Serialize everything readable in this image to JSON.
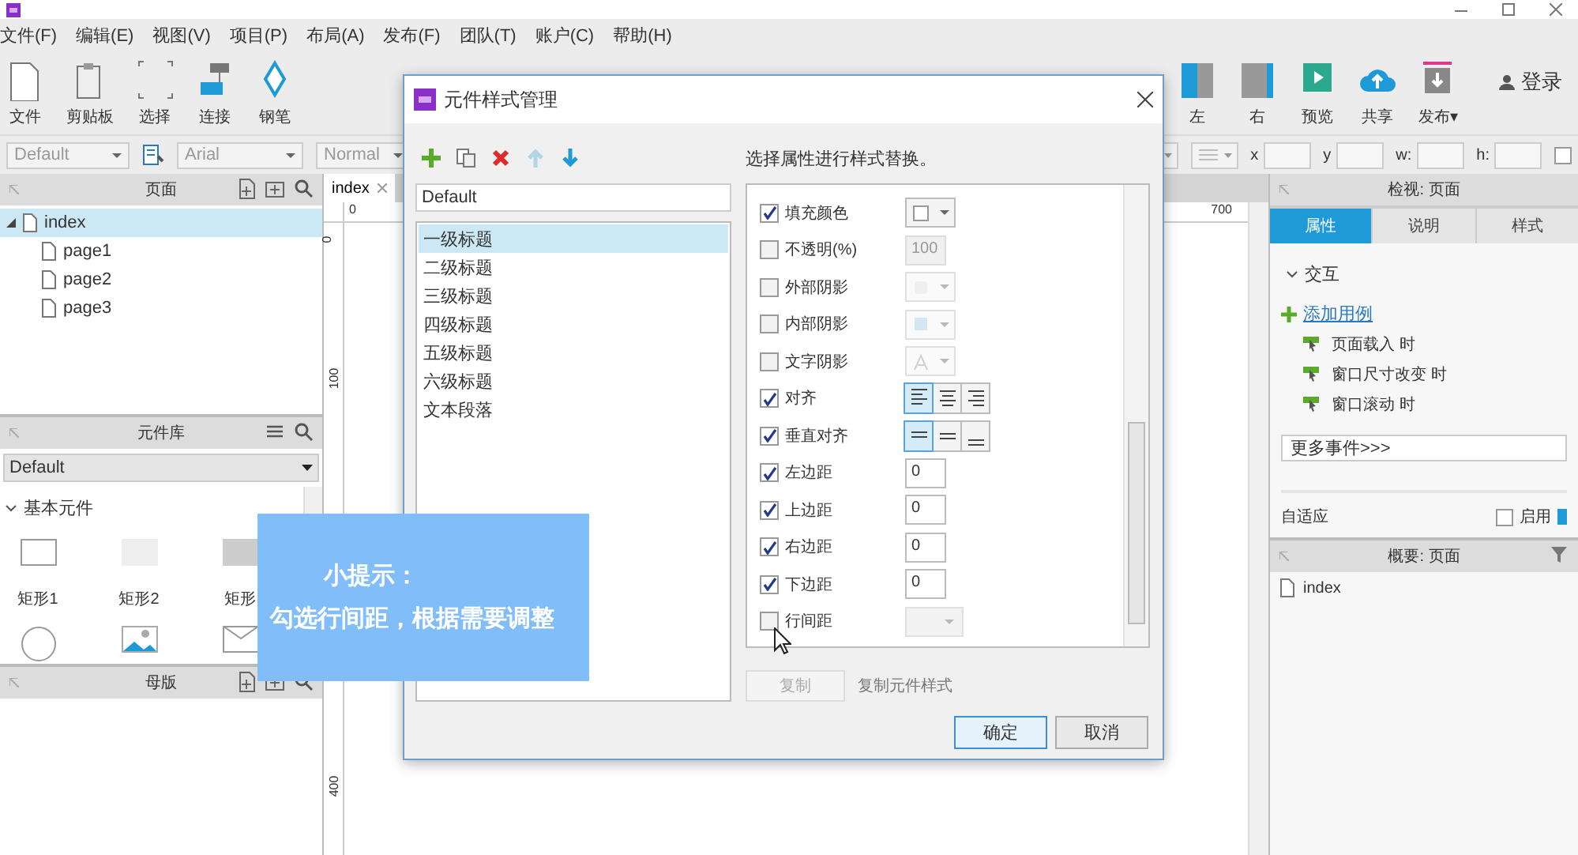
{
  "menu": [
    "文件(F)",
    "编辑(E)",
    "视图(V)",
    "项目(P)",
    "布局(A)",
    "发布(F)",
    "团队(T)",
    "账户(C)",
    "帮助(H)"
  ],
  "toolbar": {
    "left": [
      {
        "label": "文件",
        "kind": "file"
      },
      {
        "label": "剪贴板",
        "kind": "clipboard"
      },
      {
        "label": "选择",
        "kind": "select"
      },
      {
        "label": "连接",
        "kind": "connect"
      },
      {
        "label": "钢笔",
        "kind": "pen"
      }
    ],
    "right": [
      {
        "label": "左",
        "kind": "left"
      },
      {
        "label": "右",
        "kind": "right"
      },
      {
        "label": "预览",
        "kind": "preview"
      },
      {
        "label": "共享",
        "kind": "share"
      },
      {
        "label": "发布▾",
        "kind": "publish"
      }
    ],
    "login": "登录"
  },
  "format_bar": {
    "style": "Default",
    "font": "Arial",
    "weight": "Normal",
    "fields": [
      "x",
      "y",
      "w:",
      "h:"
    ],
    "checkbox_checked": false
  },
  "pages_panel": {
    "title": "页面",
    "tree": [
      {
        "label": "index",
        "selected": true,
        "expanded": true,
        "children": [
          {
            "label": "page1",
            "selected": false
          },
          {
            "label": "page2",
            "selected": false
          },
          {
            "label": "page3",
            "selected": false
          }
        ]
      }
    ]
  },
  "library_panel": {
    "title": "元件库",
    "library": "Default",
    "section": {
      "label": "基本元件",
      "expanded": true
    },
    "widgets": [
      {
        "label": "矩形1",
        "kind": "rect-outline"
      },
      {
        "label": "矩形2",
        "kind": "rect-light"
      },
      {
        "label": "矩形",
        "kind": "rect-gray"
      },
      {
        "kind": "circle"
      },
      {
        "kind": "image"
      },
      {
        "kind": "placeholder"
      }
    ]
  },
  "masters_panel": {
    "title": "母版"
  },
  "canvas": {
    "tab": "index",
    "top_ruler": [
      "0",
      "700"
    ],
    "left_ruler": [
      "0",
      "100",
      "400"
    ]
  },
  "inspector": {
    "title": "检视: 页面",
    "tabs": [
      {
        "label": "属性",
        "selected": true
      },
      {
        "label": "说明",
        "selected": false
      },
      {
        "label": "样式",
        "selected": false
      }
    ],
    "section": {
      "label": "交互",
      "expanded": true
    },
    "add_case": "添加用例",
    "events": [
      "页面载入 时",
      "窗口尺寸改变 时",
      "窗口滚动 时"
    ],
    "more_events": "更多事件>>>",
    "adaptive": {
      "label": "自适应",
      "option": "启用",
      "checked": false
    }
  },
  "outline": {
    "title": "概要: 页面",
    "items": [
      "index"
    ]
  },
  "dialog": {
    "title": "元件样式管理",
    "tools": [
      {
        "kind": "add",
        "disabled": false
      },
      {
        "kind": "duplicate",
        "disabled": false
      },
      {
        "kind": "delete",
        "disabled": false
      },
      {
        "kind": "up",
        "disabled": true
      },
      {
        "kind": "down",
        "disabled": false
      }
    ],
    "style_name": "Default",
    "styles": [
      {
        "label": "一级标题",
        "selected": true
      },
      {
        "label": "二级标题",
        "selected": false
      },
      {
        "label": "三级标题",
        "selected": false
      },
      {
        "label": "四级标题",
        "selected": false
      },
      {
        "label": "五级标题",
        "selected": false
      },
      {
        "label": "六级标题",
        "selected": false
      },
      {
        "label": "文本段落",
        "selected": false
      }
    ],
    "hint": "选择属性进行样式替换。",
    "properties": [
      {
        "label": "填充颜色",
        "checked": true,
        "kind": "color"
      },
      {
        "label": "不透明(%)",
        "checked": false,
        "kind": "number",
        "value": "100"
      },
      {
        "label": "外部阴影",
        "checked": false,
        "kind": "shadow"
      },
      {
        "label": "内部阴影",
        "checked": false,
        "kind": "inner-shadow"
      },
      {
        "label": "文字阴影",
        "checked": false,
        "kind": "text-shadow"
      },
      {
        "label": "对齐",
        "checked": true,
        "kind": "halign",
        "options": [
          {
            "kind": "left",
            "selected": true
          },
          {
            "kind": "center",
            "selected": false
          },
          {
            "kind": "right",
            "selected": false
          }
        ]
      },
      {
        "label": "垂直对齐",
        "checked": true,
        "kind": "valign",
        "options": [
          {
            "kind": "top",
            "selected": true
          },
          {
            "kind": "middle",
            "selected": false
          },
          {
            "kind": "bottom",
            "selected": false
          }
        ]
      },
      {
        "label": "左边距",
        "checked": true,
        "kind": "number",
        "value": "0"
      },
      {
        "label": "上边距",
        "checked": true,
        "kind": "number",
        "value": "0"
      },
      {
        "label": "右边距",
        "checked": true,
        "kind": "number",
        "value": "0"
      },
      {
        "label": "下边距",
        "checked": true,
        "kind": "number",
        "value": "0"
      },
      {
        "label": "行间距",
        "checked": false,
        "kind": "select"
      }
    ],
    "copy_button": "复制",
    "copy_label": "复制元件样式",
    "buttons": [
      {
        "label": "确定",
        "kind": "primary"
      },
      {
        "label": "取消",
        "kind": "normal"
      }
    ]
  },
  "tip": {
    "title": "小提示：",
    "text": "勾选行间距，根据需要调整"
  }
}
